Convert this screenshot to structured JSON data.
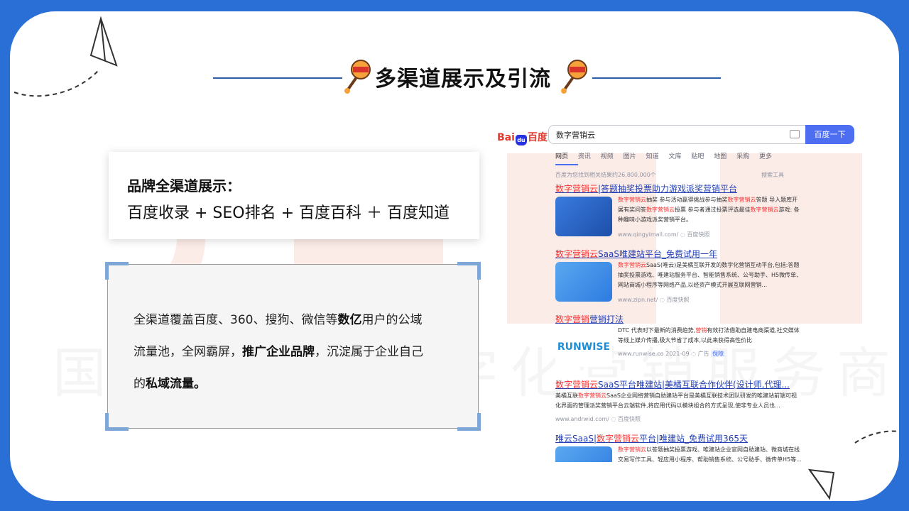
{
  "title": "多渠道展示及引流",
  "watermark": {
    "logo": "关橘互联",
    "slogan": "国内领先的数字化营销服务商"
  },
  "brand_card": {
    "heading": "品牌全渠道展示：",
    "channels": "百度收录 + SEO排名 + 百度百科 ＋ 百度知道"
  },
  "description": {
    "line1_a": "全渠道覆盖百度、360、搜狗、微信等",
    "line1_b": "数亿",
    "line1_c": "用户的公域",
    "line2_a": "流量池，全网霸屏，",
    "line2_b": "推广企业品牌",
    "line2_c": "，沉淀属于企业自己",
    "line3_a": "的",
    "line3_b": "私域流量。"
  },
  "baidu": {
    "logo_left": "Bai",
    "logo_paw": "du",
    "logo_right": "百度",
    "query": "数字营销云",
    "button": "百度一下",
    "tabs": [
      "网页",
      "资讯",
      "视频",
      "图片",
      "知道",
      "文库",
      "贴吧",
      "地图",
      "采购",
      "更多"
    ],
    "stats": "百度为您找到相关结果约26,800,000个",
    "tools": "搜索工具",
    "results": [
      {
        "title_hl": "数字营销云",
        "title_rest": "|答题抽奖投票助力游戏派奖营销平台",
        "abstract_hl1": "数字营销云",
        "abstract_1": "抽奖 参与活动赢得挑战参与抽奖",
        "abstract_hl2": "数字营销云",
        "abstract_2": "答题 导入题库开展有奖问答",
        "abstract_hl3": "数字营销云",
        "abstract_3": "投票 参与者通过投票评选最佳",
        "abstract_hl4": "数字营销云",
        "abstract_4": "游戏: 各种趣味小游戏派奖营销平台。",
        "url": "www.qingyimall.com/",
        "snapshot": "百度快照"
      },
      {
        "title_hl": "数字营销云",
        "title_rest": "SaaS唯建站平台_免费试用一年",
        "abstract_hl1": "数字营销云",
        "abstract_1": "SaaS(唯云)是美橘互联开发的数字化营销互动平台,包括:答题抽奖投票游戏、唯建站服务平台、智能销售系统、公号助手、H5微传单、网站商城小程序等网络产品,以经资产模式开展互联网营销...",
        "url": "www.zipn.net/",
        "snapshot": "百度快照"
      },
      {
        "title_hl": "数字营销",
        "title_rest": "营销打法",
        "abstract_1": "DTC 代表时下最新的消费趋势,",
        "abstract_hl1": "营销",
        "abstract_2": "有效打法借助自建电商渠道,社交媒体等线上媒介传播,极大节省了成本,以此来获得高性价比",
        "thumb_text": "RUNWISE",
        "url": "www.runwise.co  2021-09",
        "ad": "广告",
        "badge": "保障"
      },
      {
        "title_hl": "数字营销云",
        "title_rest": "SaaS平台唯建站|美橘互联合作伙伴(设计师,代理...",
        "abstract_1": "美橘互联",
        "abstract_hl1": "数字营销云",
        "abstract_2": "SaaS企业网络营销自助建站平台是美橘互联技术团队研发的唯建站前端可视化界面的管理派奖营销平台云端软件,将应用代码以模块组合的方式呈现,使非专业人员也...",
        "url": "www.andrwid.com/",
        "snapshot": "百度快照"
      },
      {
        "title_a": "唯云SaaS|",
        "title_hl": "数字营销云",
        "title_rest": "平台|唯建站_免费试用365天",
        "abstract_hl1": "数字营销云",
        "abstract_1": "以答题抽奖投票游戏、唯建站企业官网自助建站、微商城在线交易写作工具、轻应用小程序、帮助销售系统、公号助手、微传单H5等..."
      }
    ]
  },
  "colors": {
    "frame": "#2a6fd6",
    "accent": "#2d5ea8",
    "corner": "#7ea7d8",
    "baidu_red": "#f73131",
    "baidu_blue": "#4e6ef2",
    "link": "#2440b3"
  }
}
